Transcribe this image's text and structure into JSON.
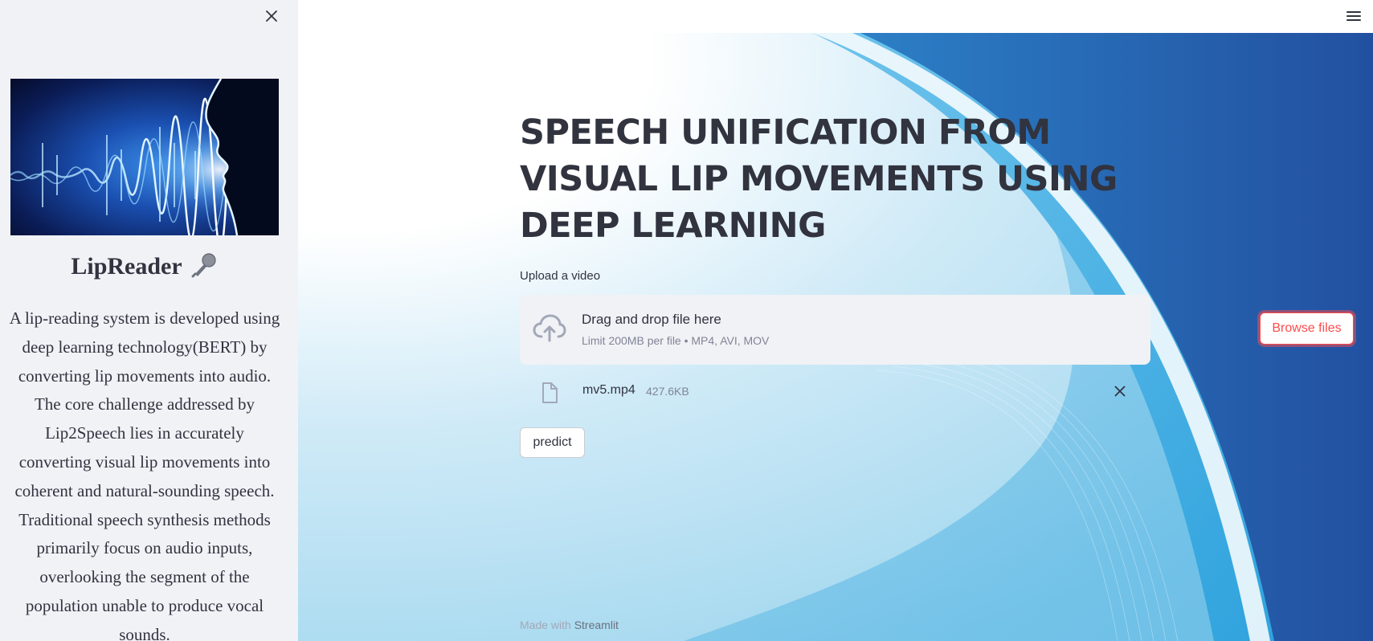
{
  "sidebar": {
    "close_icon": "close-icon",
    "image_icon": "voice-waveform-profile-image",
    "title": "LipReader",
    "title_icon": "microphone-icon",
    "description": "A lip-reading system is developed using deep learning technology(BERT) by converting lip movements into audio. The core challenge addressed by Lip2Speech lies in accurately converting visual lip movements into coherent and natural-sounding speech. Traditional speech synthesis methods primarily focus on audio inputs, overlooking the segment of the population unable to produce vocal sounds."
  },
  "header": {
    "menu_icon": "hamburger-menu-icon"
  },
  "main": {
    "title": "SPEECH UNIFICATION FROM VISUAL LIP MOVEMENTS USING DEEP LEARNING",
    "uploader": {
      "label": "Upload a video",
      "icon": "cloud-upload-icon",
      "instruction": "Drag and drop file here",
      "limit": "Limit 200MB per file • MP4, AVI, MOV",
      "browse_label": "Browse files"
    },
    "uploaded_file": {
      "icon": "file-icon",
      "name": "mv5.mp4",
      "size": "427.6KB",
      "remove_icon": "close-icon"
    },
    "predict_label": "predict"
  },
  "footer": {
    "prefix": "Made with",
    "link": "Streamlit"
  },
  "colors": {
    "sidebar_bg": "#f0f2f6",
    "text": "#31333f",
    "accent": "#ff4b4b",
    "muted": "#808495",
    "bg_blue_dark": "#2456a8",
    "bg_blue_light": "#36a6e0"
  }
}
